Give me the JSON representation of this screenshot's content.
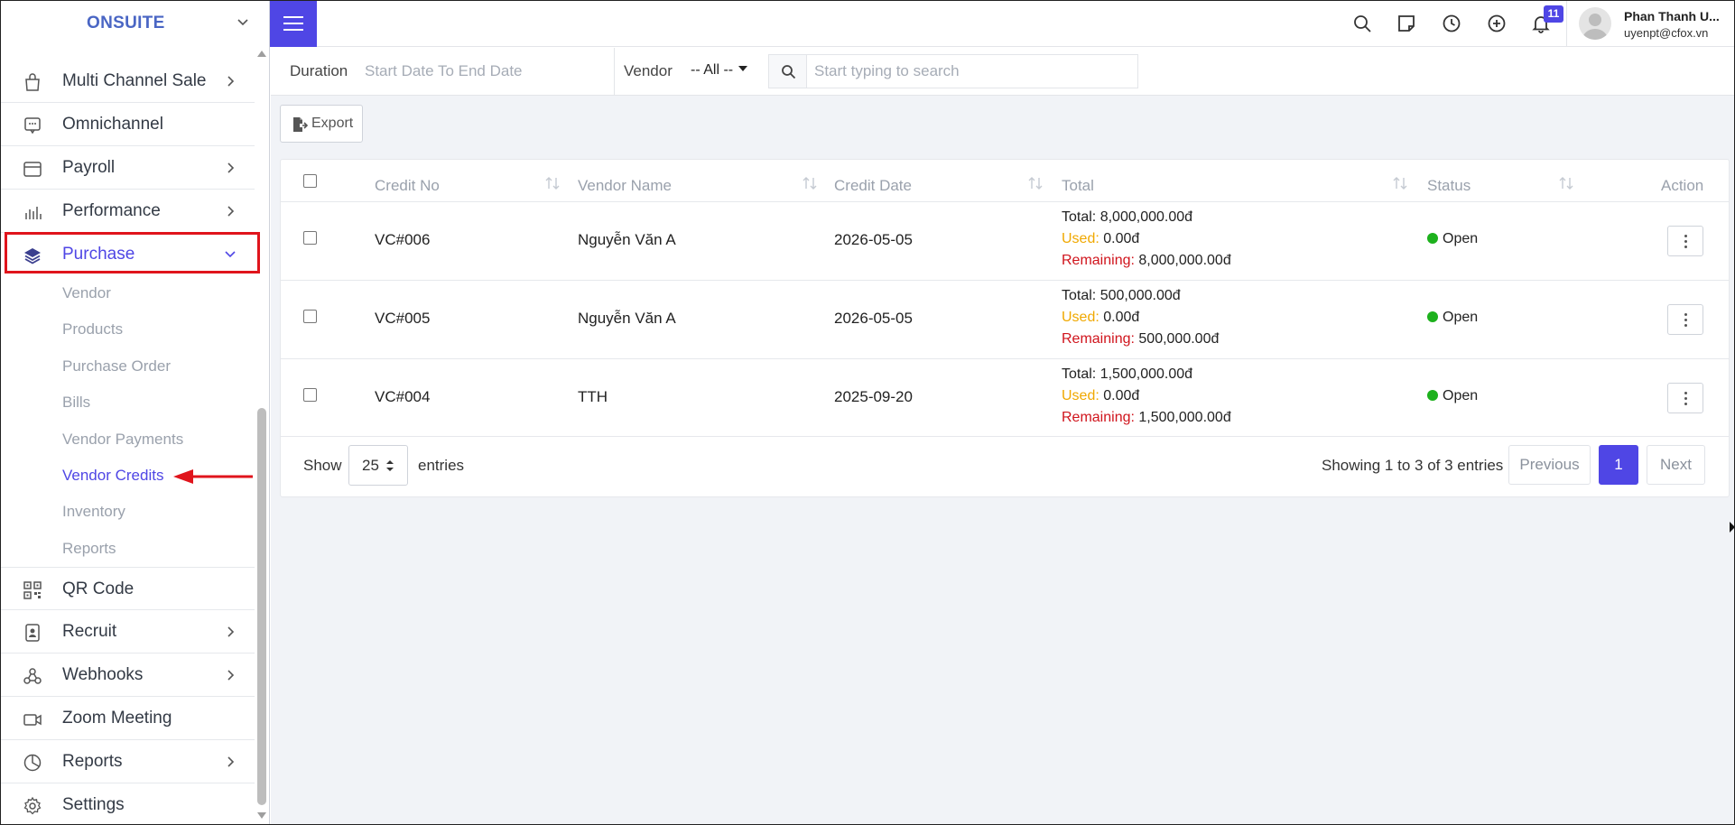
{
  "app": {
    "brand": "ONSUITE"
  },
  "sidebar": {
    "items": [
      {
        "label": "Multi Channel Sale",
        "icon": "shopping-bag-icon",
        "has_children": true
      },
      {
        "label": "Omnichannel",
        "icon": "chat-icon",
        "has_children": false
      },
      {
        "label": "Payroll",
        "icon": "wallet-icon",
        "has_children": true
      },
      {
        "label": "Performance",
        "icon": "bar-chart-icon",
        "has_children": true
      },
      {
        "label": "Purchase",
        "icon": "layers-icon",
        "has_children": true,
        "expanded": true,
        "active": true
      },
      {
        "label": "QR Code",
        "icon": "qr-code-icon",
        "has_children": false
      },
      {
        "label": "Recruit",
        "icon": "id-badge-icon",
        "has_children": true
      },
      {
        "label": "Webhooks",
        "icon": "webhook-icon",
        "has_children": true
      },
      {
        "label": "Zoom Meeting",
        "icon": "video-icon",
        "has_children": false
      },
      {
        "label": "Reports",
        "icon": "pie-chart-icon",
        "has_children": true
      },
      {
        "label": "Settings",
        "icon": "gear-icon",
        "has_children": false
      }
    ],
    "purchase_children": [
      {
        "label": "Vendor"
      },
      {
        "label": "Products"
      },
      {
        "label": "Purchase Order"
      },
      {
        "label": "Bills"
      },
      {
        "label": "Vendor Payments"
      },
      {
        "label": "Vendor Credits",
        "active": true
      },
      {
        "label": "Inventory"
      },
      {
        "label": "Reports"
      }
    ]
  },
  "topbar": {
    "icons": [
      "search-icon",
      "note-icon",
      "clock-icon",
      "plus-circle-icon",
      "bell-icon"
    ],
    "notification_count": "11",
    "user_name": "Phan Thanh U...",
    "user_email": "uyenpt@cfox.vn"
  },
  "filters": {
    "duration_label": "Duration",
    "date_placeholder": "Start Date To End Date",
    "vendor_label": "Vendor",
    "vendor_value": "-- All --",
    "search_placeholder": "Start typing to search"
  },
  "toolbar": {
    "export_label": "Export"
  },
  "table": {
    "columns": [
      "Credit No",
      "Vendor Name",
      "Credit Date",
      "Total",
      "Status",
      "Action"
    ],
    "total_prefix": "Total:",
    "used_prefix": "Used:",
    "remaining_prefix": "Remaining:",
    "rows": [
      {
        "credit_no": "VC#006",
        "vendor": "Nguyễn Văn A",
        "date": "2026-05-05",
        "total": "8,000,000.00đ",
        "used": "0.00đ",
        "remaining": "8,000,000.00đ",
        "status": "Open"
      },
      {
        "credit_no": "VC#005",
        "vendor": "Nguyễn Văn A",
        "date": "2026-05-05",
        "total": "500,000.00đ",
        "used": "0.00đ",
        "remaining": "500,000.00đ",
        "status": "Open"
      },
      {
        "credit_no": "VC#004",
        "vendor": "TTH",
        "date": "2025-09-20",
        "total": "1,500,000.00đ",
        "used": "0.00đ",
        "remaining": "1,500,000.00đ",
        "status": "Open"
      }
    ]
  },
  "pagination": {
    "show_label": "Show",
    "page_size": "25",
    "entries_label": "entries",
    "summary": "Showing 1 to 3 of 3 entries",
    "previous": "Previous",
    "current_page": "1",
    "next": "Next"
  },
  "colors": {
    "accent": "#4f46e5",
    "highlight": "#e0141c",
    "used": "#f0a800",
    "remaining": "#d0141c",
    "status_open": "#1db11d"
  }
}
